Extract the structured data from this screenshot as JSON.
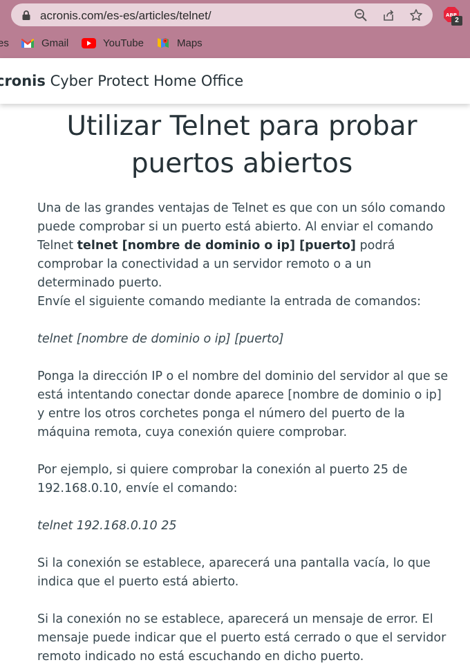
{
  "browser": {
    "url": "acronis.com/es-es/articles/telnet/",
    "extension_badge": "2",
    "extension_label": "ABP",
    "bookmarks": [
      {
        "label": "es"
      },
      {
        "label": "Gmail"
      },
      {
        "label": "YouTube"
      },
      {
        "label": "Maps"
      }
    ]
  },
  "site": {
    "brand_name": "cronis",
    "product": " Cyber Protect Home Office"
  },
  "article": {
    "title": "Utilizar Telnet para probar puertos abiertos",
    "p1_before": "Una de las grandes ventajas de Telnet es que con un sólo comando puede comprobar si un puerto está abierto. Al enviar el comando Telnet ",
    "p1_bold": "telnet [nombre de dominio o ip] [puerto]",
    "p1_after": " podrá comprobar la conectividad a un servidor remoto o a un determinado puerto.",
    "p2": "Envíe el siguiente comando mediante la entrada de comandos:",
    "cmd1": "telnet [nombre de dominio o ip] [puerto]",
    "p3": "Ponga la dirección IP o el nombre del dominio del servidor al que se está intentando conectar donde aparece [nombre de dominio o ip] y entre los otros corchetes ponga el número del puerto de la máquina remota, cuya conexión quiere comprobar.",
    "p4": "Por ejemplo, si quiere comprobar la conexión al puerto 25 de 192.168.0.10, envíe el comando:",
    "cmd2": "telnet 192.168.0.10 25",
    "p5": "Si la conexión se establece, aparecerá una pantalla vacía, lo que indica que el puerto está abierto.",
    "p6": "Si la conexión no se establece, aparecerá un mensaje de error. El mensaje puede indicar que el puerto está cerrado o que el servidor remoto indicado no está escuchando en dicho puerto."
  }
}
